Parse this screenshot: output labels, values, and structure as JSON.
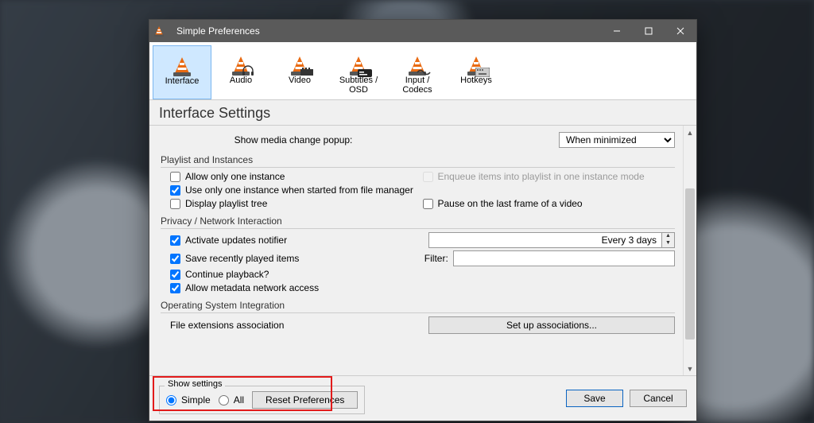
{
  "window": {
    "title": "Simple Preferences"
  },
  "tabs": [
    {
      "label": "Interface"
    },
    {
      "label": "Audio"
    },
    {
      "label": "Video"
    },
    {
      "label": "Subtitles / OSD"
    },
    {
      "label": "Input / Codecs"
    },
    {
      "label": "Hotkeys"
    }
  ],
  "heading": "Interface Settings",
  "top": {
    "media_change_label": "Show media change popup:",
    "media_change_value": "When minimized"
  },
  "groups": {
    "playlist": {
      "title": "Playlist and Instances",
      "allow_one": "Allow only one instance",
      "use_one_fm": "Use only one instance when started from file manager",
      "display_tree": "Display playlist tree",
      "enqueue": "Enqueue items into playlist in one instance mode",
      "pause_last": "Pause on the last frame of a video"
    },
    "privacy": {
      "title": "Privacy / Network Interaction",
      "updates": "Activate updates notifier",
      "updates_interval": "Every 3 days",
      "recent": "Save recently played items",
      "filter_label": "Filter:",
      "continue": "Continue playback?",
      "metadata": "Allow metadata network access"
    },
    "os": {
      "title": "Operating System Integration",
      "assoc_label": "File extensions association",
      "assoc_button": "Set up associations..."
    }
  },
  "footer": {
    "show_settings": "Show settings",
    "simple": "Simple",
    "all": "All",
    "reset": "Reset Preferences",
    "save": "Save",
    "cancel": "Cancel"
  }
}
